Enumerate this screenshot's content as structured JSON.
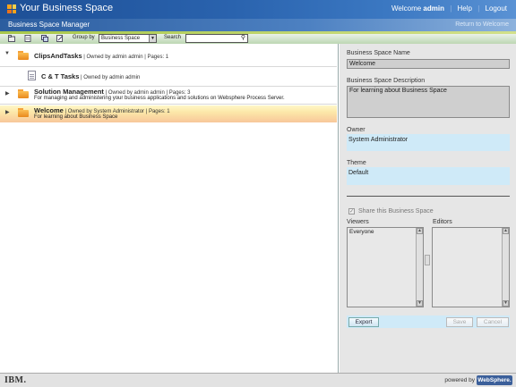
{
  "header": {
    "app_title": "Your Business Space",
    "welcome_text": "Welcome",
    "username": "admin",
    "help_link": "Help",
    "logout_link": "Logout",
    "separator": "|"
  },
  "subbar": {
    "title": "Business Space Manager",
    "return_link": "Return to Welcome"
  },
  "toolbar": {
    "group_by_label": "Group by",
    "group_by_value": "Business Space",
    "search_label": "Search",
    "search_value": ""
  },
  "spaces": [
    {
      "title": "ClipsAndTasks",
      "meta": " | Owned by admin admin | Pages: 1",
      "description": "",
      "expanded": true,
      "children": [
        {
          "title": "C & T Tasks",
          "meta": " | Owned by admin admin"
        }
      ]
    },
    {
      "title": "Solution Management",
      "meta": " | Owned by admin admin | Pages: 3",
      "description": "For managing and administering your business applications and solutions on Websphere Process Server.",
      "expanded": false
    },
    {
      "title": "Welcome",
      "meta": " | Owned by System Administrator | Pages: 1",
      "description": "For learning about Business Space",
      "expanded": false,
      "selected": true
    }
  ],
  "details": {
    "name_label": "Business Space Name",
    "name_value": "Welcome",
    "desc_label": "Business Space Description",
    "desc_value": "For learning about Business Space",
    "owner_label": "Owner",
    "owner_value": "System Administrator",
    "theme_label": "Theme",
    "theme_value": "Default",
    "share_label": "Share this Business Space",
    "share_checked": true,
    "viewers_label": "Viewers",
    "viewers": [
      "Everyone"
    ],
    "editors_label": "Editors",
    "editors": [],
    "export_label": "Export",
    "save_label": "Save",
    "cancel_label": "Cancel"
  },
  "footer": {
    "ibm_logo": "IBM.",
    "powered_by": "powered by",
    "websphere_logo": "WebSphere."
  },
  "colors": {
    "banner": "#1d4f96",
    "selected_row": "#fdd9a8",
    "panel_bg": "#e6e6e6",
    "field_highlight": "#cfeaf8",
    "folder": "#f5a23a"
  }
}
